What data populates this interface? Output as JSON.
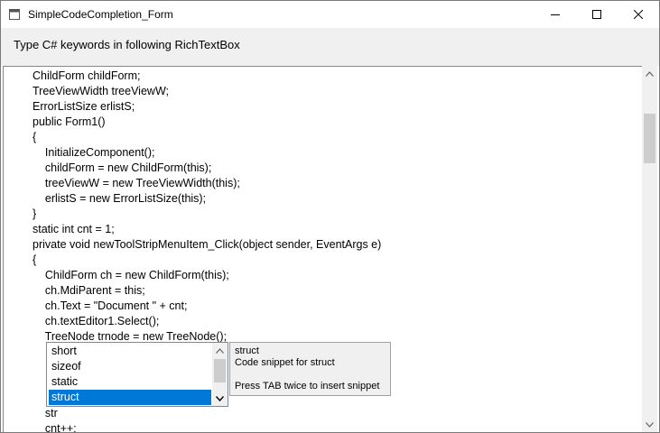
{
  "window": {
    "title": "SimpleCodeCompletion_Form",
    "icon": "app-icon",
    "controls": {
      "minimize": "minimize-icon",
      "maximize": "maximize-icon",
      "close": "close-icon"
    }
  },
  "panel": {
    "label": "Type C# keywords in following RichTextBox"
  },
  "editor": {
    "lines": [
      "ChildForm childForm;",
      "TreeViewWidth treeViewW;",
      "ErrorListSize erlistS;",
      "public Form1()",
      "{",
      "    InitializeComponent();",
      "    childForm = new ChildForm(this);",
      "    treeViewW = new TreeViewWidth(this);",
      "    erlistS = new ErrorListSize(this);",
      "}",
      "static int cnt = 1;",
      "private void newToolStripMenuItem_Click(object sender, EventArgs e)",
      "{",
      "    ChildForm ch = new ChildForm(this);",
      "    ch.MdiParent = this;",
      "    ch.Text = \"Document \" + cnt;",
      "    ch.textEditor1.Select();",
      "    TreeNode trnode = new TreeNode();",
      "",
      "",
      "",
      "",
      "    str",
      "    cnt++;"
    ]
  },
  "completion": {
    "items": [
      "short",
      "sizeof",
      "static",
      "struct"
    ],
    "selected_index": 3
  },
  "tooltip": {
    "keyword": "struct",
    "description": "Code snippet for struct",
    "hint": "Press TAB twice to insert snippet"
  },
  "colors": {
    "selection": "#0078d7",
    "panel_bg": "#f0f0f0"
  }
}
